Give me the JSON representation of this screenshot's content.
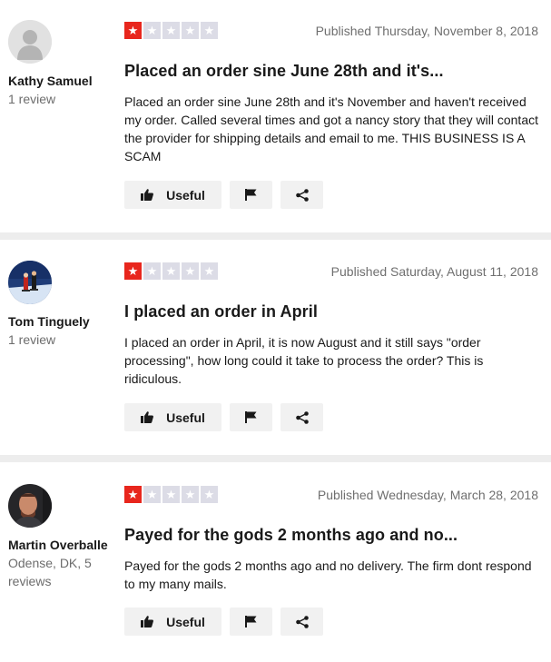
{
  "reviews": [
    {
      "user": {
        "name": "Kathy Samuel",
        "meta": "1 review",
        "avatar_icon": "default-user-avatar-icon"
      },
      "rating": 1,
      "date": "Published Thursday, November 8, 2018",
      "title": "Placed an order sine June 28th and it's...",
      "body": "Placed an order sine June 28th and it's November and haven't received my order. Called several times and got a nancy story that they will contact the provider for shipping details and email to me. THIS BUSINESS IS A SCAM",
      "useful_label": "Useful"
    },
    {
      "user": {
        "name": "Tom Tinguely",
        "meta": "1 review",
        "avatar_icon": "skiers-photo-avatar"
      },
      "rating": 1,
      "date": "Published Saturday, August 11, 2018",
      "title": "I placed an order in April",
      "body": "I placed an order in April, it is now August and it still says \"order processing\", how long could it take to process the order? This is ridiculous.",
      "useful_label": "Useful"
    },
    {
      "user": {
        "name": "Martin Overballe",
        "meta": "Odense, DK, 5 reviews",
        "avatar_icon": "person-photo-avatar"
      },
      "rating": 1,
      "date": "Published Wednesday, March 28, 2018",
      "title": "Payed for the gods 2 months ago and no...",
      "body": "Payed for the gods 2 months ago and no delivery. The firm dont respond to my many mails.",
      "useful_label": "Useful"
    }
  ],
  "colors": {
    "star_on": "#e8261d",
    "star_off": "#dcdce6",
    "button_bg": "#f1f1f1",
    "separator": "#ededed"
  }
}
